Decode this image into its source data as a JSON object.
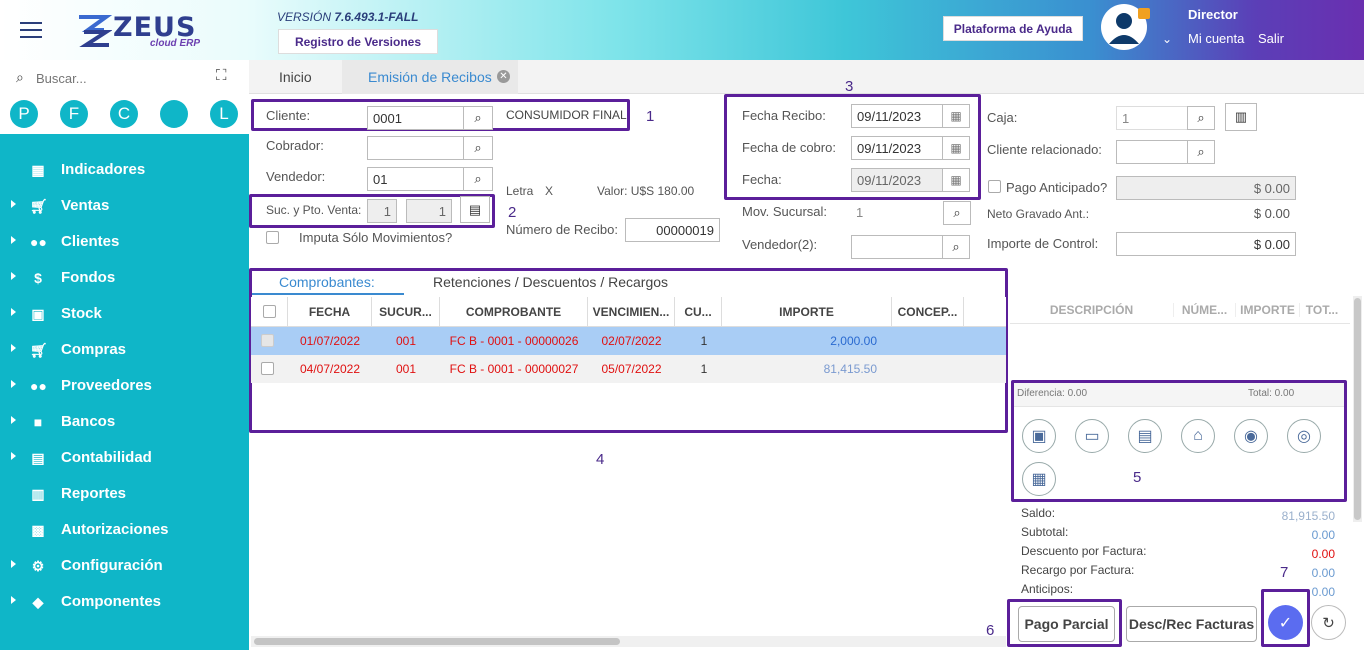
{
  "header": {
    "logo_text": "ZEUS",
    "logo_sub": "cloud ERP",
    "version_prefix": "VERSIÓN",
    "version_number": "7.6.493.1-FALL",
    "registro_label": "Registro de Versiones",
    "ayuda_label": "Plataforma de Ayuda",
    "user_role": "Director",
    "mi_cuenta": "Mi cuenta",
    "salir": "Salir"
  },
  "sidebar": {
    "search_placeholder": "Buscar...",
    "shortcuts": [
      "P",
      "F",
      "C",
      "",
      "L"
    ],
    "items": [
      {
        "label": "Indicadores",
        "icon": "dashboard-icon",
        "caret": false
      },
      {
        "label": "Ventas",
        "icon": "cart-icon",
        "caret": true
      },
      {
        "label": "Clientes",
        "icon": "people-icon",
        "caret": true
      },
      {
        "label": "Fondos",
        "icon": "dollar-icon",
        "caret": true
      },
      {
        "label": "Stock",
        "icon": "stock-icon",
        "caret": true
      },
      {
        "label": "Compras",
        "icon": "cart-plus-icon",
        "caret": true
      },
      {
        "label": "Proveedores",
        "icon": "people-icon",
        "caret": true
      },
      {
        "label": "Bancos",
        "icon": "briefcase-icon",
        "caret": true
      },
      {
        "label": "Contabilidad",
        "icon": "ledger-icon",
        "caret": true
      },
      {
        "label": "Reportes",
        "icon": "report-icon",
        "caret": false
      },
      {
        "label": "Autorizaciones",
        "icon": "lock-icon",
        "caret": false
      },
      {
        "label": "Configuración",
        "icon": "gears-icon",
        "caret": true
      },
      {
        "label": "Componentes",
        "icon": "tag-icon",
        "caret": true
      }
    ]
  },
  "tabs": {
    "inicio": "Inicio",
    "emision": "Emisión de Recibos"
  },
  "form": {
    "cliente_label": "Cliente:",
    "cliente_value": "0001",
    "cliente_name": "CONSUMIDOR FINAL",
    "cobrador_label": "Cobrador:",
    "cobrador_value": "",
    "vendedor_label": "Vendedor:",
    "vendedor_value": "01",
    "suc_label": "Suc. y Pto. Venta:",
    "suc_value": "1",
    "pto_value": "1",
    "imputa_label": "Imputa Sólo Movimientos?",
    "letra_label": "Letra",
    "letra_value": "X",
    "valor_label": "Valor: U$S 180.00",
    "nro_recibo_label": "Número de Recibo:",
    "nro_recibo_value": "00000019",
    "fecha_recibo_label": "Fecha Recibo:",
    "fecha_recibo_value": "09/11/2023",
    "fecha_cobro_label": "Fecha de cobro:",
    "fecha_cobro_value": "09/11/2023",
    "fecha_label": "Fecha:",
    "fecha_value": "09/11/2023",
    "mov_sucursal_label": "Mov. Sucursal:",
    "mov_sucursal_value": "1",
    "vendedor2_label": "Vendedor(2):",
    "vendedor2_value": "",
    "caja_label": "Caja:",
    "caja_value": "1",
    "cliente_rel_label": "Cliente relacionado:",
    "cliente_rel_value": "",
    "pago_anticipado_label": "Pago Anticipado?",
    "pago_anticipado_value": "$ 0.00",
    "neto_label": "Neto Gravado Ant.:",
    "neto_value": "$ 0.00",
    "importe_control_label": "Importe de Control:",
    "importe_control_value": "$ 0.00"
  },
  "annotations": [
    "1",
    "2",
    "3",
    "4",
    "5",
    "6",
    "7"
  ],
  "subtabs": {
    "comprobantes": "Comprobantes:",
    "retenciones": "Retenciones / Descuentos / Recargos"
  },
  "grid": {
    "columns": [
      "FECHA",
      "SUCUR...",
      "COMPROBANTE",
      "VENCIMIEN...",
      "CU...",
      "IMPORTE",
      "CONCEP..."
    ],
    "rows": [
      {
        "fecha": "01/07/2022",
        "sucursal": "001",
        "comprobante": "FC B - 0001 - 00000026",
        "vencimiento": "02/07/2022",
        "cuota": "1",
        "importe": "2,000.00"
      },
      {
        "fecha": "04/07/2022",
        "sucursal": "001",
        "comprobante": "FC B - 0001 - 00000027",
        "vencimiento": "05/07/2022",
        "cuota": "1",
        "importe": "81,415.50"
      }
    ]
  },
  "right_grid": {
    "columns": [
      "DESCRIPCIÓN",
      "NÚME...",
      "IMPORTE",
      "TOT..."
    ],
    "diferencia": "Diferencia: 0.00",
    "total": "Total: 0.00"
  },
  "totals": [
    {
      "label": "Saldo:",
      "value": "81,915.50",
      "color": "#9ab0cc"
    },
    {
      "label": "Subtotal:",
      "value": "0.00",
      "color": "#6a9ad0"
    },
    {
      "label": "Descuento por Factura:",
      "value": "0.00",
      "color": "#e01010"
    },
    {
      "label": "Recargo por Factura:",
      "value": "0.00",
      "color": "#6a9ad0"
    },
    {
      "label": "Anticipos:",
      "value": "0.00",
      "color": "#6a9ad0"
    }
  ],
  "actions": {
    "pago_parcial": "Pago Parcial",
    "desc_rec": "Desc/Rec Facturas"
  },
  "colors": {
    "accent": "#0fb6c8",
    "highlight": "#5b1f9a",
    "selected_row": "#a9cdf5"
  }
}
